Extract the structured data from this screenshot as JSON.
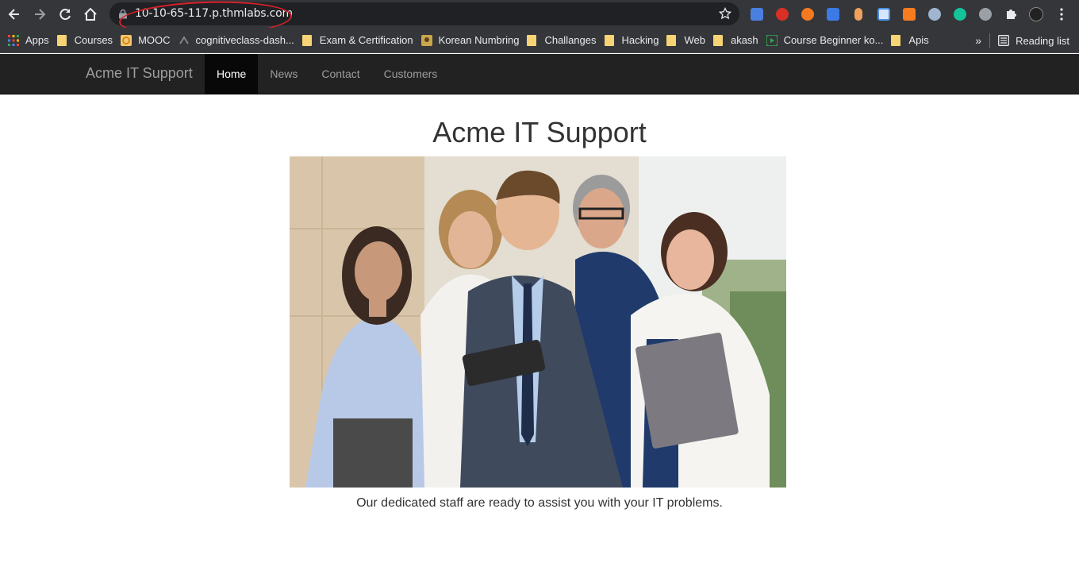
{
  "browser": {
    "url": "10-10-65-117.p.thmlabs.com",
    "bookmarks": [
      {
        "label": "Apps",
        "icon": "apps-grid-icon"
      },
      {
        "label": "Courses",
        "icon": "folder-icon"
      },
      {
        "label": "MOOC",
        "icon": "mooc-icon"
      },
      {
        "label": "cognitiveclass-dash...",
        "icon": "cognitiveclass-icon"
      },
      {
        "label": "Exam & Certification",
        "icon": "folder-icon"
      },
      {
        "label": "Korean Numbring",
        "icon": "korean-site-icon"
      },
      {
        "label": "Challanges",
        "icon": "folder-icon"
      },
      {
        "label": "Hacking",
        "icon": "folder-icon"
      },
      {
        "label": "Web",
        "icon": "folder-icon"
      },
      {
        "label": "akash",
        "icon": "folder-icon"
      },
      {
        "label": "Course Beginner ko...",
        "icon": "course-play-icon"
      },
      {
        "label": "Apis",
        "icon": "folder-icon"
      }
    ],
    "overflow_label": "»",
    "reading_list_label": "Reading list"
  },
  "site": {
    "brand": "Acme IT Support",
    "nav": [
      {
        "label": "Home",
        "active": true
      },
      {
        "label": "News",
        "active": false
      },
      {
        "label": "Contact",
        "active": false
      },
      {
        "label": "Customers",
        "active": false
      }
    ],
    "title": "Acme IT Support",
    "caption": "Our dedicated staff are ready to assist you with your IT problems."
  },
  "colors": {
    "annotation": "#d8202a",
    "navbar": "#222222",
    "active_nav": "#080808"
  }
}
